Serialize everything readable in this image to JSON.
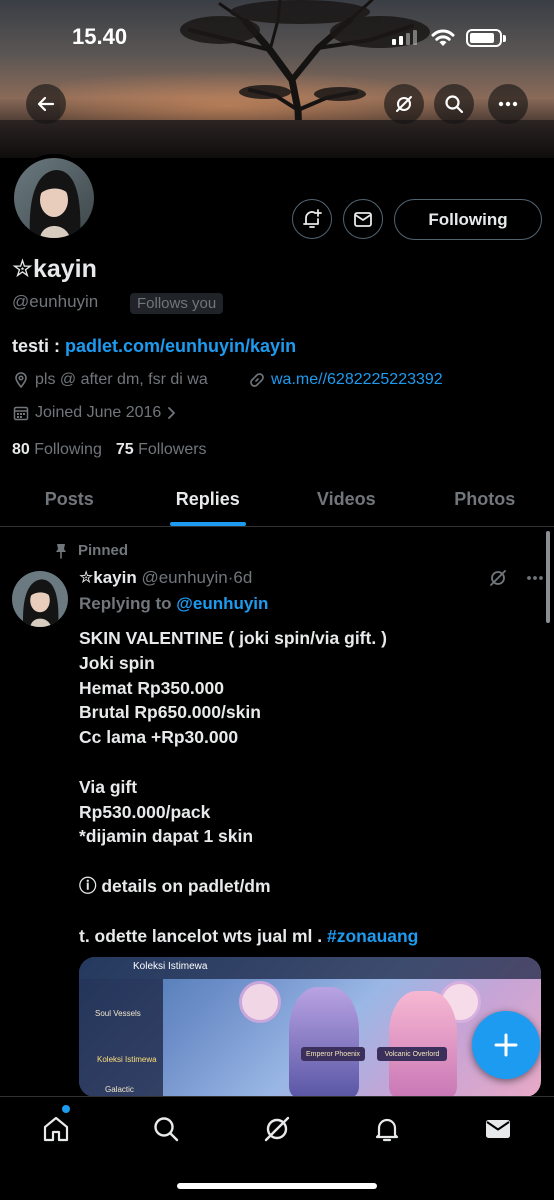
{
  "status_bar": {
    "time": "15.40"
  },
  "header": {
    "back_icon": "arrow-left-icon",
    "actions": [
      "grok-icon",
      "search-icon",
      "more-icon"
    ]
  },
  "profile": {
    "name": "✮kayin",
    "handle": "@eunhuyin",
    "follows_you": "Follows you",
    "follow_button": "Following",
    "action_icons": [
      "notification-plus-icon",
      "message-icon"
    ],
    "bio_prefix": "testi : ",
    "bio_link": "padlet.com/eunhuyin/kayin",
    "location": "pls @ after dm, fsr di wa",
    "website": "wa.me//6282225223392",
    "joined": "Joined June 2016",
    "following_count": "80",
    "following_label": "Following",
    "followers_count": "75",
    "followers_label": "Followers"
  },
  "tabs": [
    {
      "label": "Posts",
      "active": false
    },
    {
      "label": "Replies",
      "active": true
    },
    {
      "label": "Videos",
      "active": false
    },
    {
      "label": "Photos",
      "active": false
    }
  ],
  "tweet": {
    "pinned_label": "Pinned",
    "author_name": "✮kayin",
    "author_handle": "@eunhuyin",
    "separator": "·",
    "time": "6d",
    "replying_prefix": "Replying to ",
    "replying_to": "@eunhuyin",
    "body_lines": [
      "SKIN VALENTINE ( joki spin/via gift. )",
      "Joki spin",
      "Hemat Rp350.000",
      "Brutal Rp650.000/skin",
      "Cc lama +Rp30.000",
      "",
      "Via gift",
      "Rp530.000/pack",
      "*dijamin dapat 1 skin",
      "",
      "ⓘ details on padlet/dm",
      "",
      "t. odette lancelot wts jual ml . "
    ],
    "hashtag": "#zonauang",
    "media": {
      "header_text": "Koleksi Istimewa",
      "side_labels": [
        "Soul Vessels",
        "Koleksi Istimewa",
        "Galactic"
      ],
      "plates": [
        "Emperor Phoenix",
        "Volcanic Overlord"
      ]
    }
  },
  "fab_icon": "plus-icon",
  "bottom_nav": [
    "home-icon",
    "search-icon",
    "grok-icon",
    "notifications-icon",
    "messages-icon"
  ],
  "colors": {
    "accent": "#1d9bf0",
    "background": "#000000",
    "text": "#e7e9ea",
    "muted": "#71767b"
  }
}
